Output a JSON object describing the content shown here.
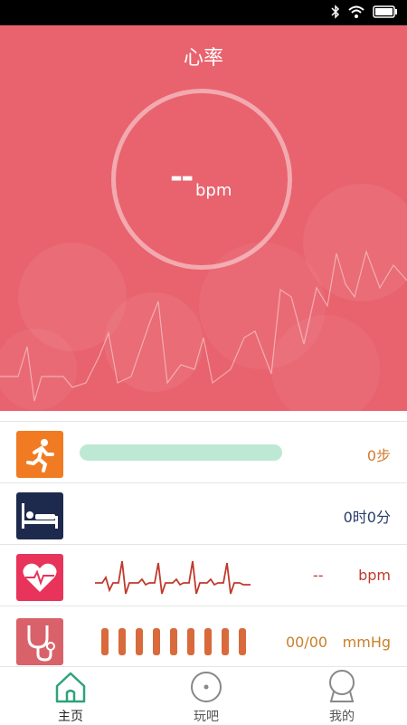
{
  "header": {
    "title": "心率"
  },
  "heart_rate": {
    "value": "--",
    "unit": "bpm"
  },
  "rows": [
    {
      "label": "steps",
      "value": "0步",
      "icon": "running-icon",
      "color": "#d27a2e",
      "progress": 0
    },
    {
      "label": "sleep",
      "value": "0时0分",
      "icon": "bed-icon",
      "color": "#2b3d6b"
    },
    {
      "label": "heart",
      "value": "--",
      "unit": "bpm",
      "icon": "heart-ecg-icon",
      "color": "#c0392b"
    },
    {
      "label": "blood_pressure",
      "value": "00/00",
      "unit": "mmHg",
      "icon": "stethoscope-icon",
      "color": "#c8802a"
    }
  ],
  "tabs": [
    {
      "label": "主页",
      "icon": "home-icon",
      "active": true
    },
    {
      "label": "玩吧",
      "icon": "play-icon",
      "active": false
    },
    {
      "label": "我的",
      "icon": "profile-icon",
      "active": false
    }
  ],
  "colors": {
    "hero": "#e8636e",
    "tab_active": "#2ea37a",
    "tab_inactive": "#888888"
  }
}
